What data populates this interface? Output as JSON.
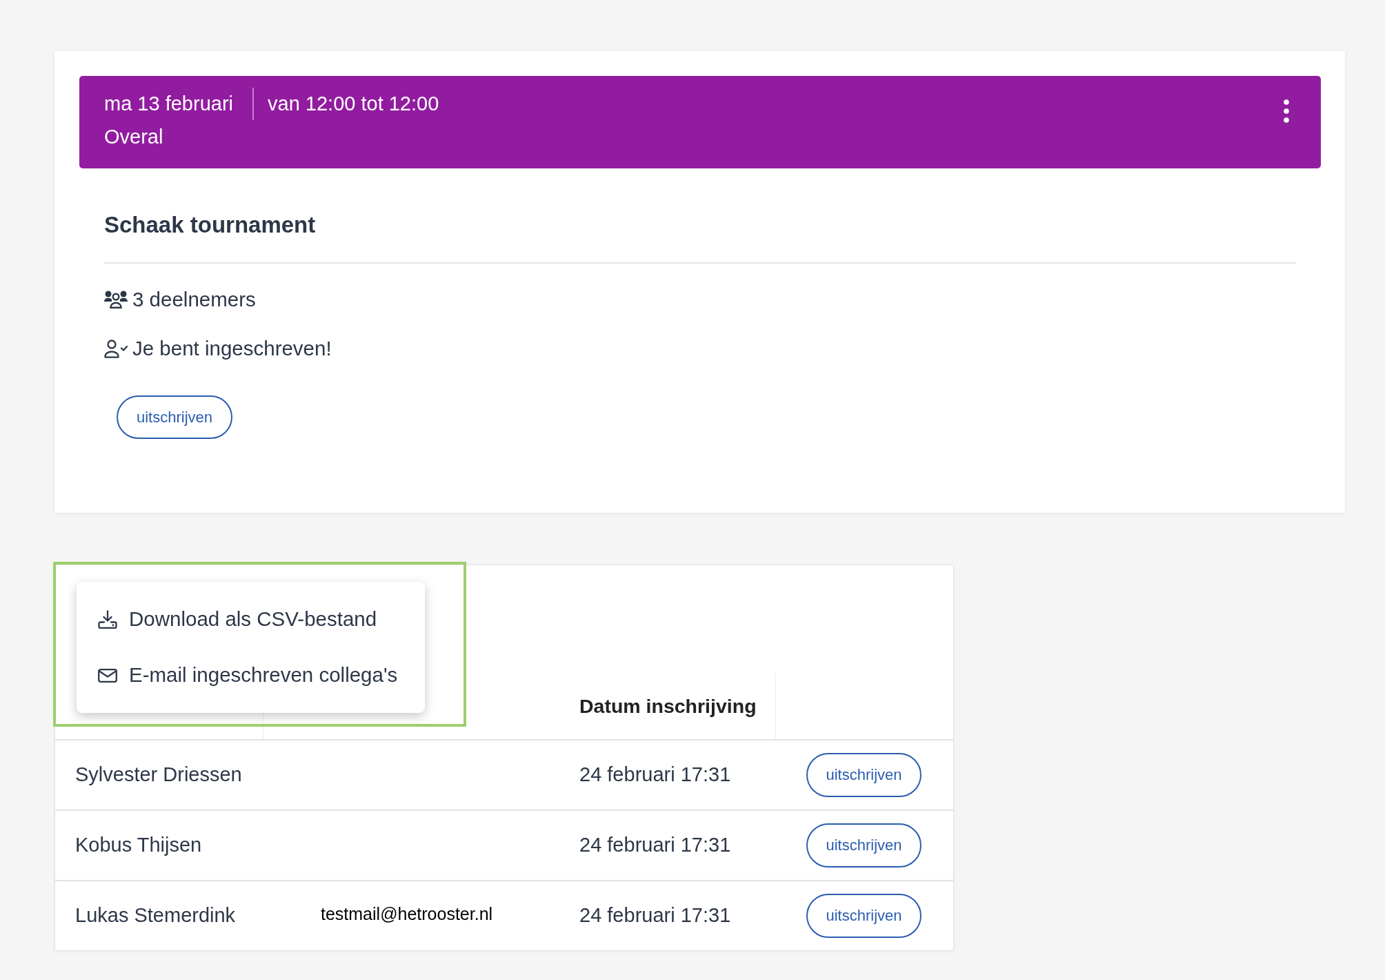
{
  "event": {
    "date": "ma 13 februari",
    "time": "van 12:00 tot 12:00",
    "location": "Overal",
    "title": "Schaak tournament",
    "participants": "3 deelnemers",
    "registration": "Je bent ingeschreven!",
    "button": "uitschrijven"
  },
  "participants_menu": {
    "highlighted": true,
    "items": [
      {
        "kind": "download",
        "label": "Download als CSV-bestand"
      },
      {
        "kind": "email",
        "label": "E-mail ingeschreven collega's"
      }
    ]
  },
  "participants_table": {
    "date_heading": "Datum inschrijving",
    "rows": [
      {
        "name": "Sylvester Driessen",
        "date": "24 februari 17:31",
        "button": "uitschrijven"
      },
      {
        "name": "Kobus Thijsen",
        "date": "24 februari 17:31",
        "button": "uitschrijven"
      },
      {
        "name": "Lukas Stemerdink",
        "email": "testmail@hetrooster.nl",
        "date": "24 februari 17:31",
        "button": "uitschrijven"
      }
    ]
  }
}
